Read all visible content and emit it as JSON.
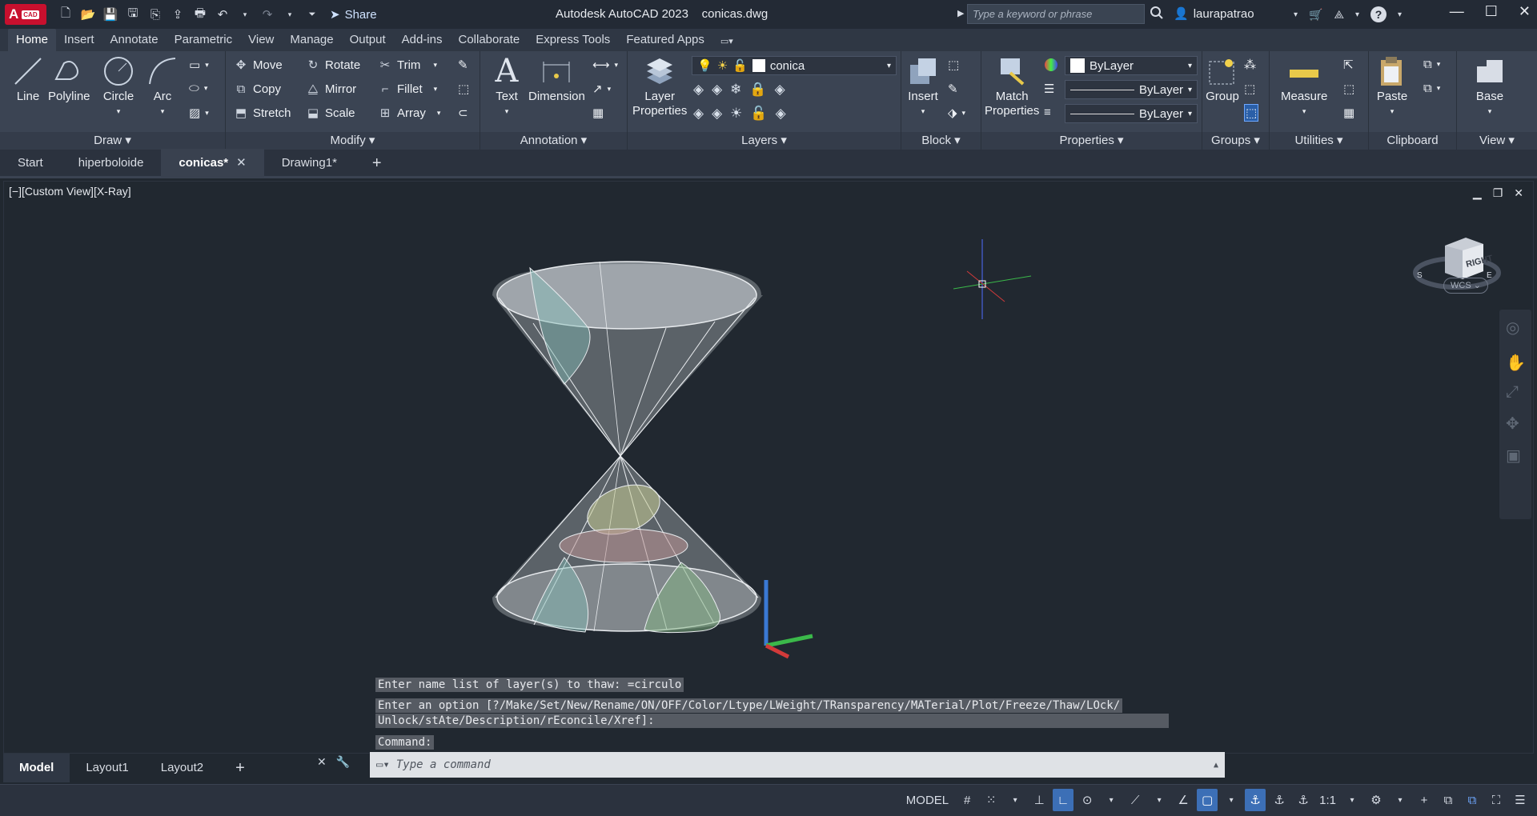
{
  "app": {
    "logo_text": "A",
    "logo_badge": "CAD",
    "title": "Autodesk AutoCAD 2023",
    "filename": "conicas.dwg",
    "share_label": "Share",
    "search_placeholder": "Type a keyword or phrase",
    "user": "laurapatrao"
  },
  "ribbon_tabs": [
    "Home",
    "Insert",
    "Annotate",
    "Parametric",
    "View",
    "Manage",
    "Output",
    "Add-ins",
    "Collaborate",
    "Express Tools",
    "Featured Apps"
  ],
  "panels": {
    "draw": {
      "title": "Draw",
      "line": "Line",
      "polyline": "Polyline",
      "circle": "Circle",
      "arc": "Arc"
    },
    "modify": {
      "title": "Modify",
      "move": "Move",
      "rotate": "Rotate",
      "trim": "Trim",
      "copy": "Copy",
      "mirror": "Mirror",
      "fillet": "Fillet",
      "stretch": "Stretch",
      "scale": "Scale",
      "array": "Array"
    },
    "annotation": {
      "title": "Annotation",
      "text": "Text",
      "dimension": "Dimension"
    },
    "layers": {
      "title": "Layers",
      "layer_properties_1": "Layer",
      "layer_properties_2": "Properties",
      "current_layer": "conica"
    },
    "block": {
      "title": "Block",
      "insert": "Insert"
    },
    "properties": {
      "title": "Properties",
      "match_1": "Match",
      "match_2": "Properties",
      "color": "ByLayer",
      "linetype": "ByLayer",
      "lineweight": "ByLayer"
    },
    "groups": {
      "title": "Groups",
      "group": "Group"
    },
    "utilities": {
      "title": "Utilities",
      "measure": "Measure"
    },
    "clipboard": {
      "title": "Clipboard",
      "paste": "Paste"
    },
    "view": {
      "title": "View",
      "base": "Base"
    }
  },
  "doc_tabs": [
    {
      "label": "Start",
      "active": false
    },
    {
      "label": "hiperboloide",
      "active": false
    },
    {
      "label": "conicas*",
      "active": true
    },
    {
      "label": "Drawing1*",
      "active": false
    }
  ],
  "viewport": {
    "label": "[−][Custom View][X-Ray]",
    "viewcube_face": "RIGHT",
    "wcs_label": "WCS"
  },
  "command_history": [
    "Enter name list of layer(s) to thaw: =circulo",
    "Enter an option [?/Make/Set/New/Rename/ON/OFF/Color/Ltype/LWeight/TRansparency/MATerial/Plot/Freeze/Thaw/LOck/",
    "Unlock/stAte/Description/rEconcile/Xref]:",
    "Command:"
  ],
  "command_placeholder": "Type a command",
  "layout_tabs": [
    {
      "label": "Model",
      "active": true
    },
    {
      "label": "Layout1",
      "active": false
    },
    {
      "label": "Layout2",
      "active": false
    }
  ],
  "status": {
    "model_label": "MODEL",
    "scale": "1:1"
  },
  "colors": {
    "accent": "#3c6fb6",
    "background": "#212830",
    "ribbon": "#3b4453"
  }
}
